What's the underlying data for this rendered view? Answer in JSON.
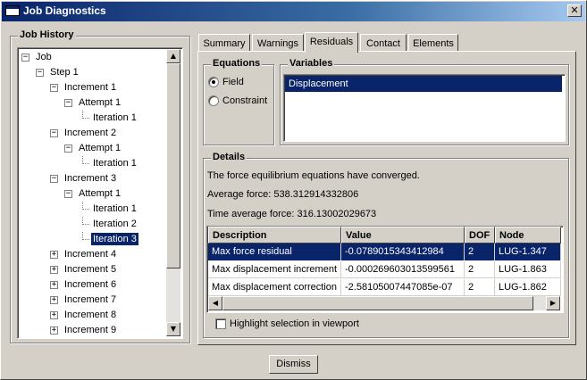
{
  "window": {
    "title": "Job Diagnostics",
    "close_glyph": "✕"
  },
  "job_history": {
    "legend": "Job History",
    "tree": [
      {
        "label": "Job",
        "expander": "−"
      },
      {
        "label": "Step 1",
        "expander": "−"
      },
      {
        "label": "Increment 1",
        "expander": "−"
      },
      {
        "label": "Attempt 1",
        "expander": "−"
      },
      {
        "label": "Iteration 1",
        "expander": ""
      },
      {
        "label": "Increment 2",
        "expander": "−"
      },
      {
        "label": "Attempt 1",
        "expander": "−"
      },
      {
        "label": "Iteration 1",
        "expander": ""
      },
      {
        "label": "Increment 3",
        "expander": "−"
      },
      {
        "label": "Attempt 1",
        "expander": "−"
      },
      {
        "label": "Iteration 1",
        "expander": ""
      },
      {
        "label": "Iteration 2",
        "expander": ""
      },
      {
        "label": "Iteration 3",
        "expander": "",
        "selected": true
      },
      {
        "label": "Increment 4",
        "expander": "+"
      },
      {
        "label": "Increment 5",
        "expander": "+"
      },
      {
        "label": "Increment 6",
        "expander": "+"
      },
      {
        "label": "Increment 7",
        "expander": "+"
      },
      {
        "label": "Increment 8",
        "expander": "+"
      },
      {
        "label": "Increment 9",
        "expander": "+"
      }
    ]
  },
  "tabs": [
    {
      "label": "Summary"
    },
    {
      "label": "Warnings"
    },
    {
      "label": "Residuals",
      "active": true
    },
    {
      "label": "Contact"
    },
    {
      "label": "Elements"
    }
  ],
  "equations": {
    "legend": "Equations",
    "options": [
      {
        "label": "Field",
        "selected": true
      },
      {
        "label": "Constraint",
        "selected": false
      }
    ]
  },
  "variables": {
    "legend": "Variables",
    "items": [
      {
        "label": "Displacement",
        "selected": true
      }
    ]
  },
  "details": {
    "legend": "Details",
    "message": "The force equilibrium equations have converged.",
    "average_force": "Average force: 538.312914332806",
    "time_average_force": "Time average force: 316.13002029673",
    "columns": [
      "Description",
      "Value",
      "DOF",
      "Node"
    ],
    "rows": [
      {
        "description": "Max force residual",
        "value": "-0.0789015343412984",
        "dof": "2",
        "node": "LUG-1.347",
        "selected": true
      },
      {
        "description": "Max displacement increment",
        "value": "-0.000269603013599561",
        "dof": "2",
        "node": "LUG-1.863"
      },
      {
        "description": "Max displacement correction",
        "value": "-2.58105007447085e-07",
        "dof": "2",
        "node": "LUG-1.862"
      }
    ],
    "highlight_label": "Highlight selection in viewport",
    "highlight_checked": false
  },
  "buttons": {
    "dismiss": "Dismiss"
  },
  "scroll_glyphs": {
    "up": "▲",
    "down": "▼",
    "left": "◀",
    "right": "▶"
  },
  "colors": {
    "selection": "#0a246a",
    "face": "#d4d0c8",
    "title_start": "#0a246a"
  }
}
